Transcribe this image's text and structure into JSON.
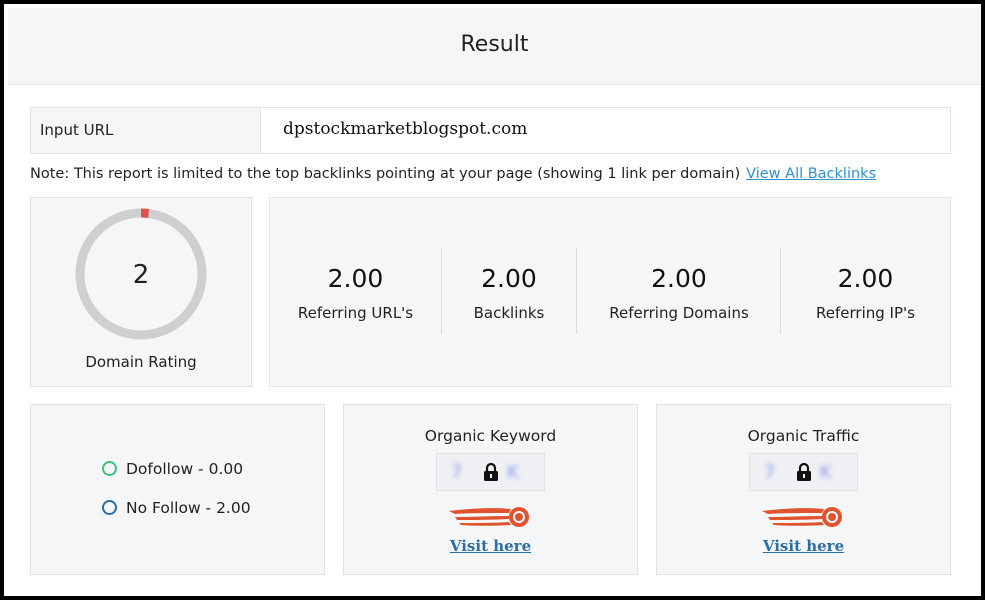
{
  "header": {
    "title": "Result"
  },
  "input": {
    "label": "Input URL",
    "value": "dpstockmarketblogspot.com"
  },
  "note": {
    "text": "Note: This report is limited to the top backlinks pointing at your page (showing 1 link per domain)",
    "link": "View All Backlinks"
  },
  "domain_rating": {
    "value": "2",
    "label": "Domain Rating",
    "ring_fill_fraction": 0.02,
    "colors": {
      "track": "#cfcfcf",
      "fill": "#e05050"
    }
  },
  "stats": [
    {
      "value": "2.00",
      "label": "Referring URL's"
    },
    {
      "value": "2.00",
      "label": "Backlinks"
    },
    {
      "value": "2.00",
      "label": "Referring Domains"
    },
    {
      "value": "2.00",
      "label": "Referring IP's"
    }
  ],
  "follow": {
    "dofollow": {
      "label": "Dofollow - 0.00",
      "color": "#3fbf7f"
    },
    "nofollow": {
      "label": "No Follow - 2.00",
      "color": "#2a6ea6"
    }
  },
  "organic_keyword": {
    "title": "Organic Keyword",
    "link": "Visit here",
    "icon": "lock-icon"
  },
  "organic_traffic": {
    "title": "Organic Traffic",
    "link": "Visit here",
    "icon": "lock-icon"
  },
  "brand_colors": {
    "accent_link": "#2f8fd1",
    "rocket": "#e0532f"
  }
}
